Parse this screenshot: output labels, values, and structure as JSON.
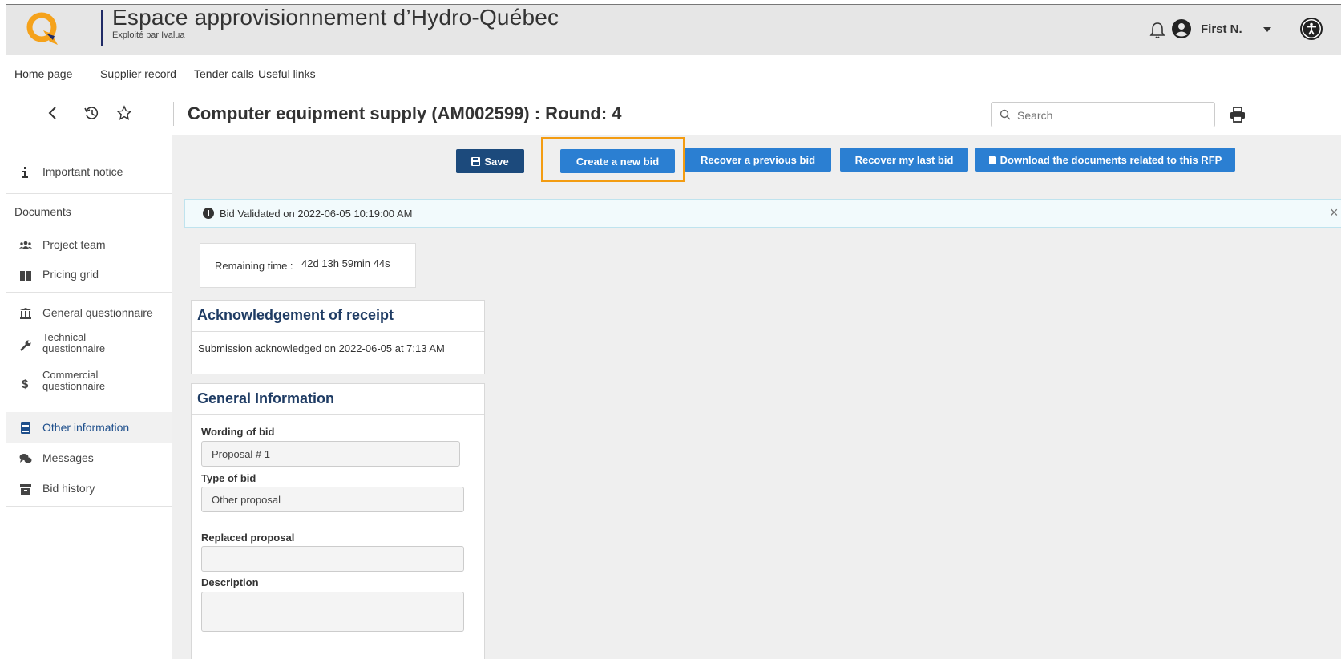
{
  "header": {
    "title": "Espace approvisionnement d’Hydro-Québec",
    "subtitle": "Exploité par Ivalua",
    "user_name": "First N.",
    "icons": [
      "hydro-quebec-logo",
      "bell-icon",
      "user-circle-icon",
      "caret-down-icon",
      "accessibility-icon"
    ]
  },
  "nav": {
    "items": [
      "Home page",
      "Supplier record",
      "Tender calls",
      "Useful links"
    ]
  },
  "titlebar": {
    "title": "Computer equipment supply (AM002599) : Round: 4",
    "search_placeholder": "Search"
  },
  "sidebar": {
    "important_notice": "Important notice",
    "documents_heading": "Documents",
    "project_team": "Project team",
    "pricing_grid": "Pricing grid",
    "general_questionnaire": "General questionnaire",
    "technical_questionnaire_1": "Technical",
    "technical_questionnaire_2": "questionnaire",
    "commercial_questionnaire_1": "Commercial",
    "commercial_questionnaire_2": "questionnaire",
    "other_information": "Other information",
    "messages": "Messages",
    "bid_history": "Bid history"
  },
  "actions": {
    "save": "Save",
    "create_new_bid": "Create a new bid",
    "recover_previous_bid": "Recover a previous bid",
    "recover_last_bid": "Recover my last bid",
    "download_documents": "Download the documents related to this RFP"
  },
  "alert": {
    "text": "Bid Validated on 2022-06-05 10:19:00 AM",
    "close": "×"
  },
  "remaining": {
    "label": "Remaining time :",
    "value": "42d 13h 59min 44s"
  },
  "ack": {
    "title": "Acknowledgement of receipt",
    "text": "Submission acknowledged on 2022-06-05 at 7:13 AM"
  },
  "general": {
    "title": "General Information",
    "wording_label": "Wording of bid",
    "wording_value": "Proposal # 1",
    "type_label": "Type of bid",
    "type_value": "Other proposal",
    "replaced_label": "Replaced proposal",
    "replaced_value": "",
    "description_label": "Description",
    "description_value": ""
  },
  "colors": {
    "save_button": "#1c4a7c",
    "primary_button": "#2b7fd2",
    "highlight": "#f39c12",
    "header_bg": "#e6e6e6",
    "logo_orange": "#f5a21b"
  }
}
